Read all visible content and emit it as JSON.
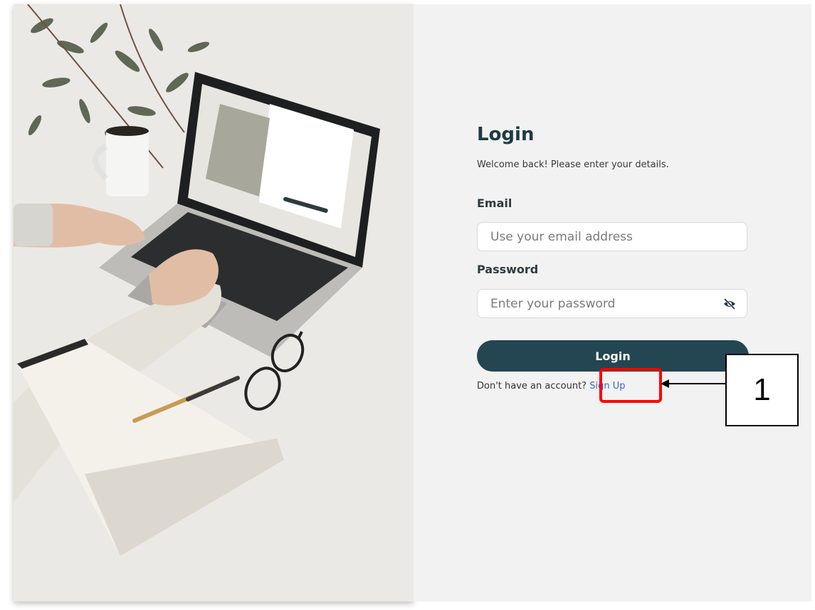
{
  "login": {
    "title": "Login",
    "subtitle": "Welcome back! Please enter your details.",
    "email_label": "Email",
    "email_placeholder": "Use your email address",
    "password_label": "Password",
    "password_placeholder": "Enter your password",
    "submit_label": "Login",
    "signup_prompt": "Don't have an account?",
    "signup_link": "Sign Up",
    "toggle_icon": "eye-off-icon"
  },
  "annotation": {
    "number": "1"
  },
  "colors": {
    "primary": "#244552",
    "title": "#1e3a45",
    "link": "#3d64c7",
    "panel_bg": "#f2f2f2",
    "highlight": "#ff0000"
  }
}
